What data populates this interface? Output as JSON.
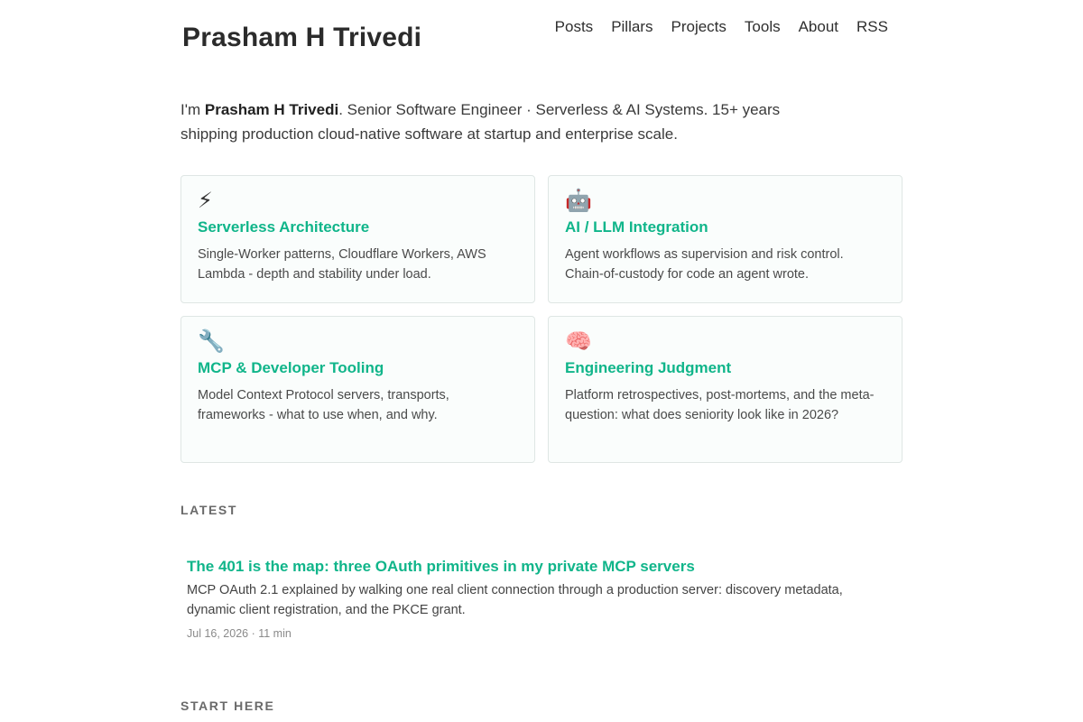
{
  "header": {
    "site_title": "Prasham H Trivedi",
    "nav": [
      "Posts",
      "Pillars",
      "Projects",
      "Tools",
      "About",
      "RSS"
    ]
  },
  "intro": {
    "prefix": "I'm ",
    "name": "Prasham H Trivedi",
    "text": ". Senior Software Engineer · Serverless & AI Systems. 15+ years shipping production cloud-native software at startup and enterprise scale."
  },
  "pillars": [
    {
      "icon": "⚡",
      "icon_name": "lightning-icon",
      "title": "Serverless Architecture",
      "description": "Single-Worker patterns, Cloudflare Workers, AWS Lambda - depth and stability under load."
    },
    {
      "icon": "🤖",
      "icon_name": "robot-icon",
      "title": "AI / LLM Integration",
      "description": "Agent workflows as supervision and risk control. Chain-of-custody for code an agent wrote."
    },
    {
      "icon": "🔧",
      "icon_name": "wrench-icon",
      "title": "MCP & Developer Tooling",
      "description": "Model Context Protocol servers, transports, frameworks - what to use when, and why."
    },
    {
      "icon": "🧠",
      "icon_name": "brain-icon",
      "title": "Engineering Judgment",
      "description": "Platform retrospectives, post-mortems, and the meta-question: what does seniority look like in 2026?"
    }
  ],
  "latest": {
    "heading": "LATEST",
    "post": {
      "title": "The 401 is the map: three OAuth primitives in my private MCP servers",
      "excerpt": "MCP OAuth 2.1 explained by walking one real client connection through a production server: discovery metadata, dynamic client registration, and the PKCE grant.",
      "meta": "Jul 16, 2026 · 11 min"
    }
  },
  "start_here": {
    "heading": "START HERE"
  },
  "colors": {
    "accent": "#10b58a",
    "text": "#333333",
    "card_border": "#dfe6e4",
    "card_bg": "#fafdfc",
    "muted": "#8a8a8a"
  }
}
